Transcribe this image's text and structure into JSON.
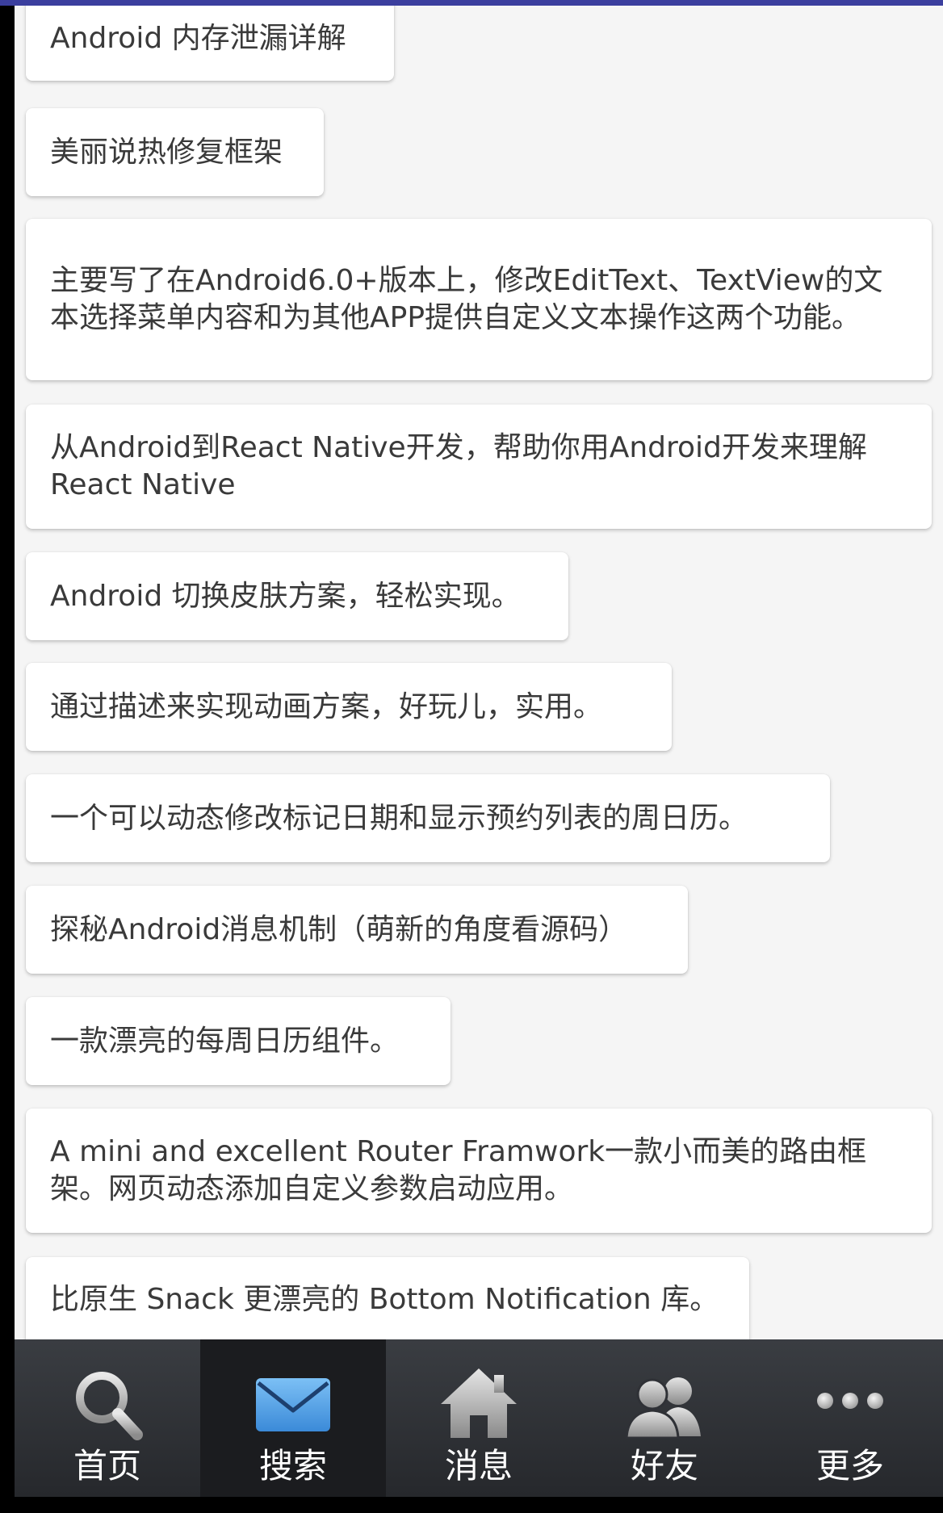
{
  "list": {
    "items": [
      "Android 内存泄漏详解",
      "美丽说热修复框架",
      "主要写了在Android6.0+版本上，修改EditText、TextView的文本选择菜单内容和为其他APP提供自定义文本操作这两个功能。",
      "从Android到React Native开发，帮助你用Android开发来理解React Native",
      "Android 切换皮肤方案，轻松实现。",
      "通过描述来实现动画方案，好玩儿，实用。",
      "一个可以动态修改标记日期和显示预约列表的周日历。",
      "探秘Android消息机制（萌新的角度看源码）",
      "一款漂亮的每周日历组件。",
      "A mini and excellent Router Framwork一款小而美的路由框架。网页动态添加自定义参数启动应用。",
      "比原生 Snack 更漂亮的 Bottom Notification 库。"
    ]
  },
  "nav": {
    "items": [
      {
        "label": "首页",
        "icon": "search-icon"
      },
      {
        "label": "搜索",
        "icon": "mail-icon",
        "active": true
      },
      {
        "label": "消息",
        "icon": "home-icon"
      },
      {
        "label": "好友",
        "icon": "friends-icon"
      },
      {
        "label": "更多",
        "icon": "more-icon"
      }
    ]
  },
  "colors": {
    "accent_bar": "#3b3f9e",
    "background": "#f5f5f5",
    "card": "#ffffff",
    "text": "#3a3a3a",
    "navbar": "#2f3136",
    "nav_active": "#1b1c1f",
    "mail_icon": "#4aa0e6"
  }
}
